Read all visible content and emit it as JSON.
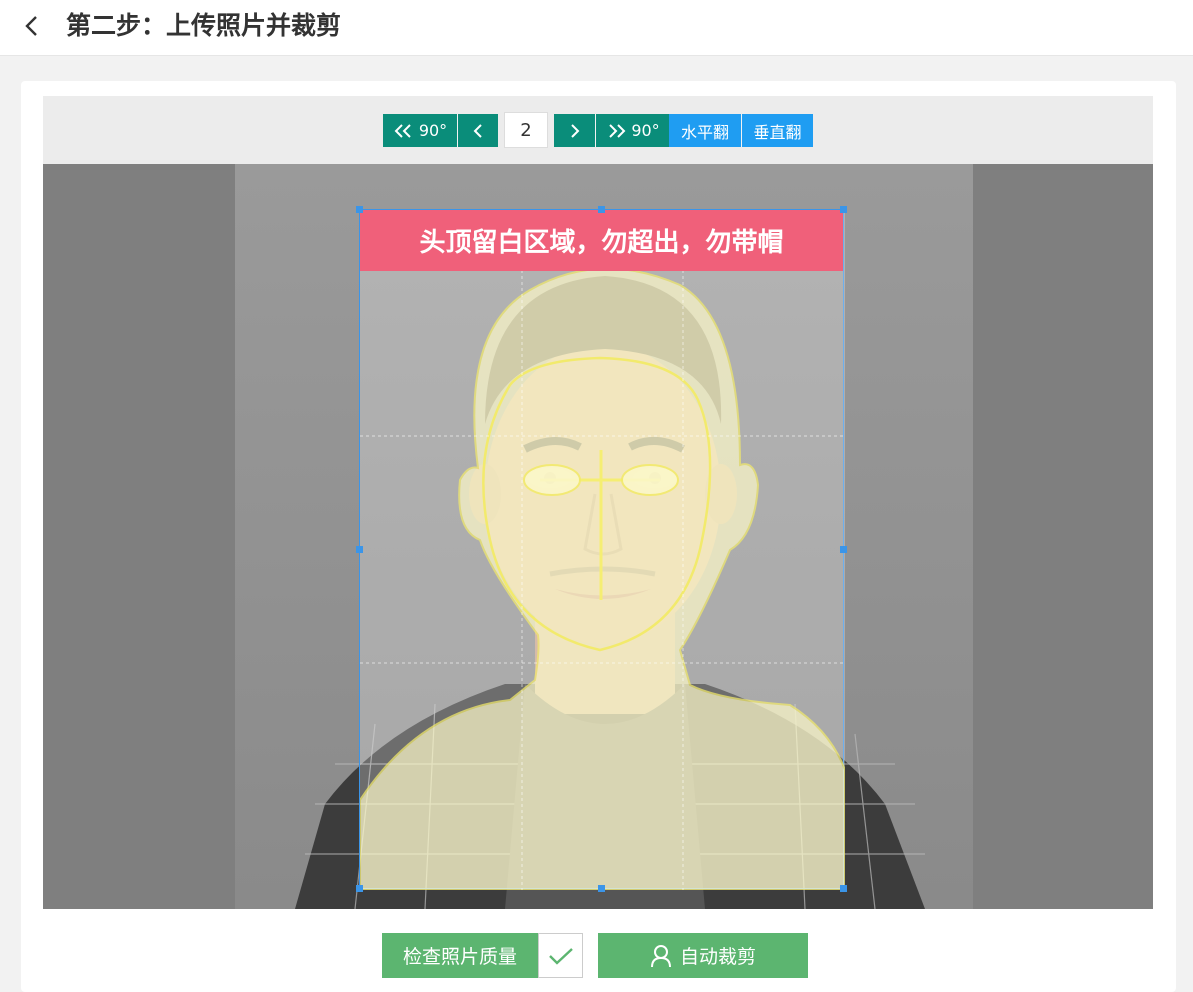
{
  "header": {
    "title": "第二步：上传照片并裁剪"
  },
  "toolbar": {
    "rotate_left": "90°",
    "page": "2",
    "rotate_right": "90°",
    "flip_h": "水平翻",
    "flip_v": "垂直翻"
  },
  "overlay": {
    "banner": "头顶留白区域，勿超出，勿带帽"
  },
  "actions": {
    "check_quality": "检查照片质量",
    "auto_crop": "自动裁剪"
  },
  "colors": {
    "teal": "#0a8d7a",
    "blue": "#1f9df2",
    "green": "#5cb570",
    "banner": "#f0607a"
  }
}
